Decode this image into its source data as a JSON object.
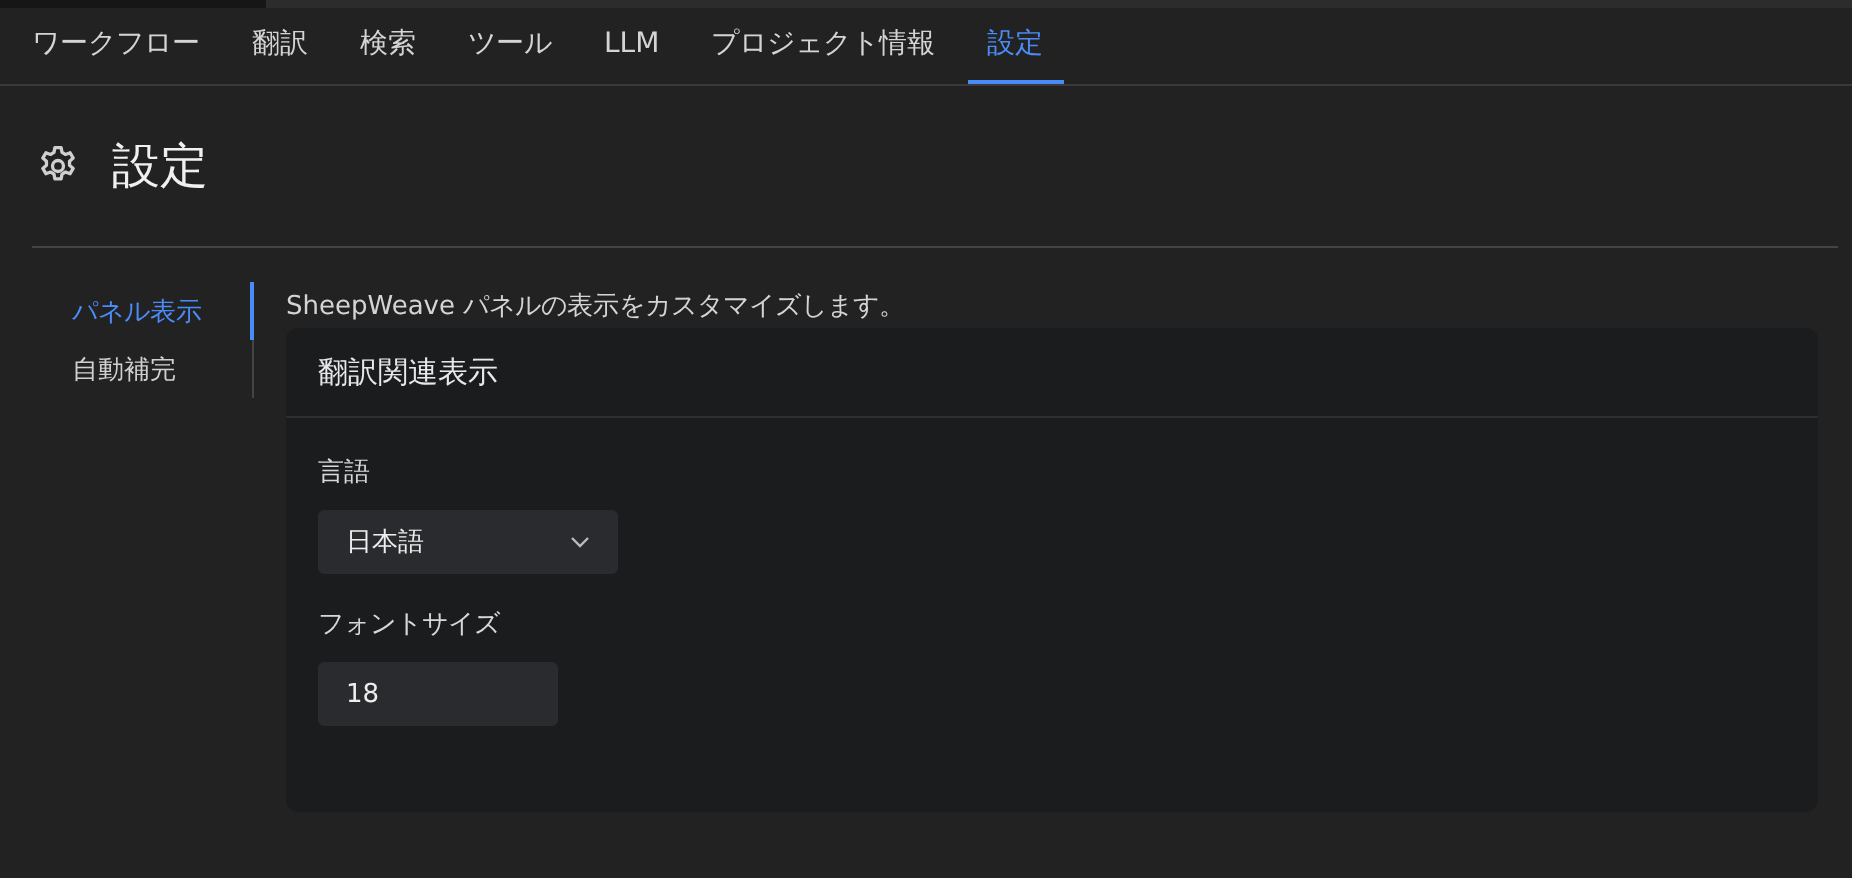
{
  "tabs": [
    {
      "label": "ワークフロー",
      "selected": false
    },
    {
      "label": "翻訳",
      "selected": false
    },
    {
      "label": "検索",
      "selected": false
    },
    {
      "label": "ツール",
      "selected": false
    },
    {
      "label": "LLM",
      "selected": false
    },
    {
      "label": "プロジェクト情報",
      "selected": false
    },
    {
      "label": "設定",
      "selected": true
    }
  ],
  "page_title": "設定",
  "sidebar": {
    "items": [
      {
        "label": "パネル表示",
        "selected": true
      },
      {
        "label": "自動補完",
        "selected": false
      }
    ]
  },
  "description": "SheepWeave パネルの表示をカスタマイズします。",
  "card": {
    "title": "翻訳関連表示",
    "fields": [
      {
        "kind": "select",
        "label": "言語",
        "value": "日本語"
      },
      {
        "kind": "number",
        "label": "フォントサイズ",
        "value": "18"
      }
    ]
  }
}
